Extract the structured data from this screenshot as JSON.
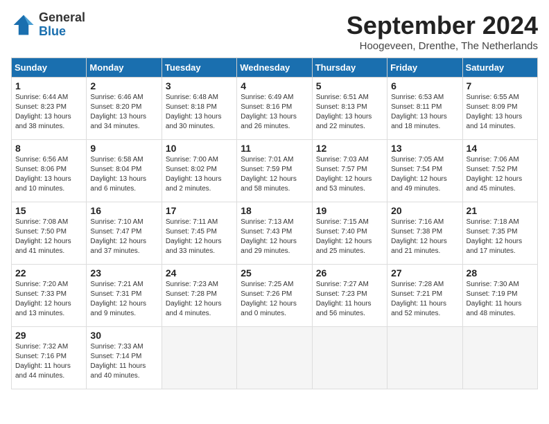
{
  "header": {
    "logo_general": "General",
    "logo_blue": "Blue",
    "title": "September 2024",
    "location": "Hoogeveen, Drenthe, The Netherlands"
  },
  "weekdays": [
    "Sunday",
    "Monday",
    "Tuesday",
    "Wednesday",
    "Thursday",
    "Friday",
    "Saturday"
  ],
  "weeks": [
    [
      {
        "day": "1",
        "text": "Sunrise: 6:44 AM\nSunset: 8:23 PM\nDaylight: 13 hours\nand 38 minutes."
      },
      {
        "day": "2",
        "text": "Sunrise: 6:46 AM\nSunset: 8:20 PM\nDaylight: 13 hours\nand 34 minutes."
      },
      {
        "day": "3",
        "text": "Sunrise: 6:48 AM\nSunset: 8:18 PM\nDaylight: 13 hours\nand 30 minutes."
      },
      {
        "day": "4",
        "text": "Sunrise: 6:49 AM\nSunset: 8:16 PM\nDaylight: 13 hours\nand 26 minutes."
      },
      {
        "day": "5",
        "text": "Sunrise: 6:51 AM\nSunset: 8:13 PM\nDaylight: 13 hours\nand 22 minutes."
      },
      {
        "day": "6",
        "text": "Sunrise: 6:53 AM\nSunset: 8:11 PM\nDaylight: 13 hours\nand 18 minutes."
      },
      {
        "day": "7",
        "text": "Sunrise: 6:55 AM\nSunset: 8:09 PM\nDaylight: 13 hours\nand 14 minutes."
      }
    ],
    [
      {
        "day": "8",
        "text": "Sunrise: 6:56 AM\nSunset: 8:06 PM\nDaylight: 13 hours\nand 10 minutes."
      },
      {
        "day": "9",
        "text": "Sunrise: 6:58 AM\nSunset: 8:04 PM\nDaylight: 13 hours\nand 6 minutes."
      },
      {
        "day": "10",
        "text": "Sunrise: 7:00 AM\nSunset: 8:02 PM\nDaylight: 13 hours\nand 2 minutes."
      },
      {
        "day": "11",
        "text": "Sunrise: 7:01 AM\nSunset: 7:59 PM\nDaylight: 12 hours\nand 58 minutes."
      },
      {
        "day": "12",
        "text": "Sunrise: 7:03 AM\nSunset: 7:57 PM\nDaylight: 12 hours\nand 53 minutes."
      },
      {
        "day": "13",
        "text": "Sunrise: 7:05 AM\nSunset: 7:54 PM\nDaylight: 12 hours\nand 49 minutes."
      },
      {
        "day": "14",
        "text": "Sunrise: 7:06 AM\nSunset: 7:52 PM\nDaylight: 12 hours\nand 45 minutes."
      }
    ],
    [
      {
        "day": "15",
        "text": "Sunrise: 7:08 AM\nSunset: 7:50 PM\nDaylight: 12 hours\nand 41 minutes."
      },
      {
        "day": "16",
        "text": "Sunrise: 7:10 AM\nSunset: 7:47 PM\nDaylight: 12 hours\nand 37 minutes."
      },
      {
        "day": "17",
        "text": "Sunrise: 7:11 AM\nSunset: 7:45 PM\nDaylight: 12 hours\nand 33 minutes."
      },
      {
        "day": "18",
        "text": "Sunrise: 7:13 AM\nSunset: 7:43 PM\nDaylight: 12 hours\nand 29 minutes."
      },
      {
        "day": "19",
        "text": "Sunrise: 7:15 AM\nSunset: 7:40 PM\nDaylight: 12 hours\nand 25 minutes."
      },
      {
        "day": "20",
        "text": "Sunrise: 7:16 AM\nSunset: 7:38 PM\nDaylight: 12 hours\nand 21 minutes."
      },
      {
        "day": "21",
        "text": "Sunrise: 7:18 AM\nSunset: 7:35 PM\nDaylight: 12 hours\nand 17 minutes."
      }
    ],
    [
      {
        "day": "22",
        "text": "Sunrise: 7:20 AM\nSunset: 7:33 PM\nDaylight: 12 hours\nand 13 minutes."
      },
      {
        "day": "23",
        "text": "Sunrise: 7:21 AM\nSunset: 7:31 PM\nDaylight: 12 hours\nand 9 minutes."
      },
      {
        "day": "24",
        "text": "Sunrise: 7:23 AM\nSunset: 7:28 PM\nDaylight: 12 hours\nand 4 minutes."
      },
      {
        "day": "25",
        "text": "Sunrise: 7:25 AM\nSunset: 7:26 PM\nDaylight: 12 hours\nand 0 minutes."
      },
      {
        "day": "26",
        "text": "Sunrise: 7:27 AM\nSunset: 7:23 PM\nDaylight: 11 hours\nand 56 minutes."
      },
      {
        "day": "27",
        "text": "Sunrise: 7:28 AM\nSunset: 7:21 PM\nDaylight: 11 hours\nand 52 minutes."
      },
      {
        "day": "28",
        "text": "Sunrise: 7:30 AM\nSunset: 7:19 PM\nDaylight: 11 hours\nand 48 minutes."
      }
    ],
    [
      {
        "day": "29",
        "text": "Sunrise: 7:32 AM\nSunset: 7:16 PM\nDaylight: 11 hours\nand 44 minutes."
      },
      {
        "day": "30",
        "text": "Sunrise: 7:33 AM\nSunset: 7:14 PM\nDaylight: 11 hours\nand 40 minutes."
      },
      {
        "day": "",
        "text": ""
      },
      {
        "day": "",
        "text": ""
      },
      {
        "day": "",
        "text": ""
      },
      {
        "day": "",
        "text": ""
      },
      {
        "day": "",
        "text": ""
      }
    ]
  ]
}
